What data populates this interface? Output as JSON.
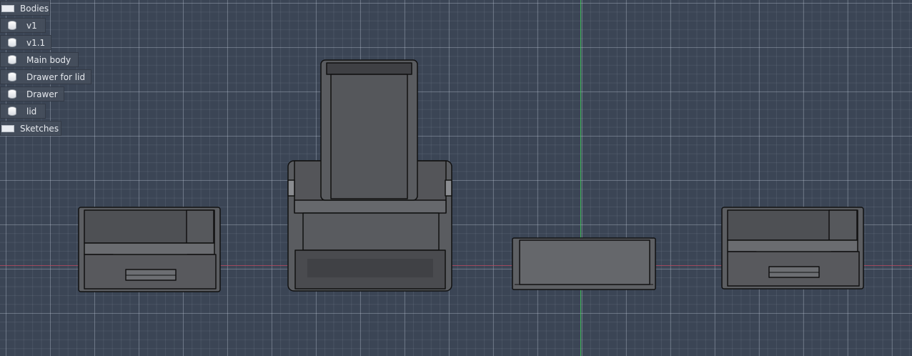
{
  "browser": {
    "bodies_label": "Bodies",
    "sketches_label": "Sketches",
    "bodies": [
      {
        "label": "v1"
      },
      {
        "label": "v1.1"
      },
      {
        "label": "Main body"
      },
      {
        "label": "Drawer for lid"
      },
      {
        "label": "Drawer"
      },
      {
        "label": "lid"
      }
    ]
  },
  "colors": {
    "grid_background": "#3b4555",
    "y_axis": "#3fcf5a",
    "x_axis": "#c24a60",
    "model_body": "#5a5c60",
    "model_edge": "#111111"
  }
}
